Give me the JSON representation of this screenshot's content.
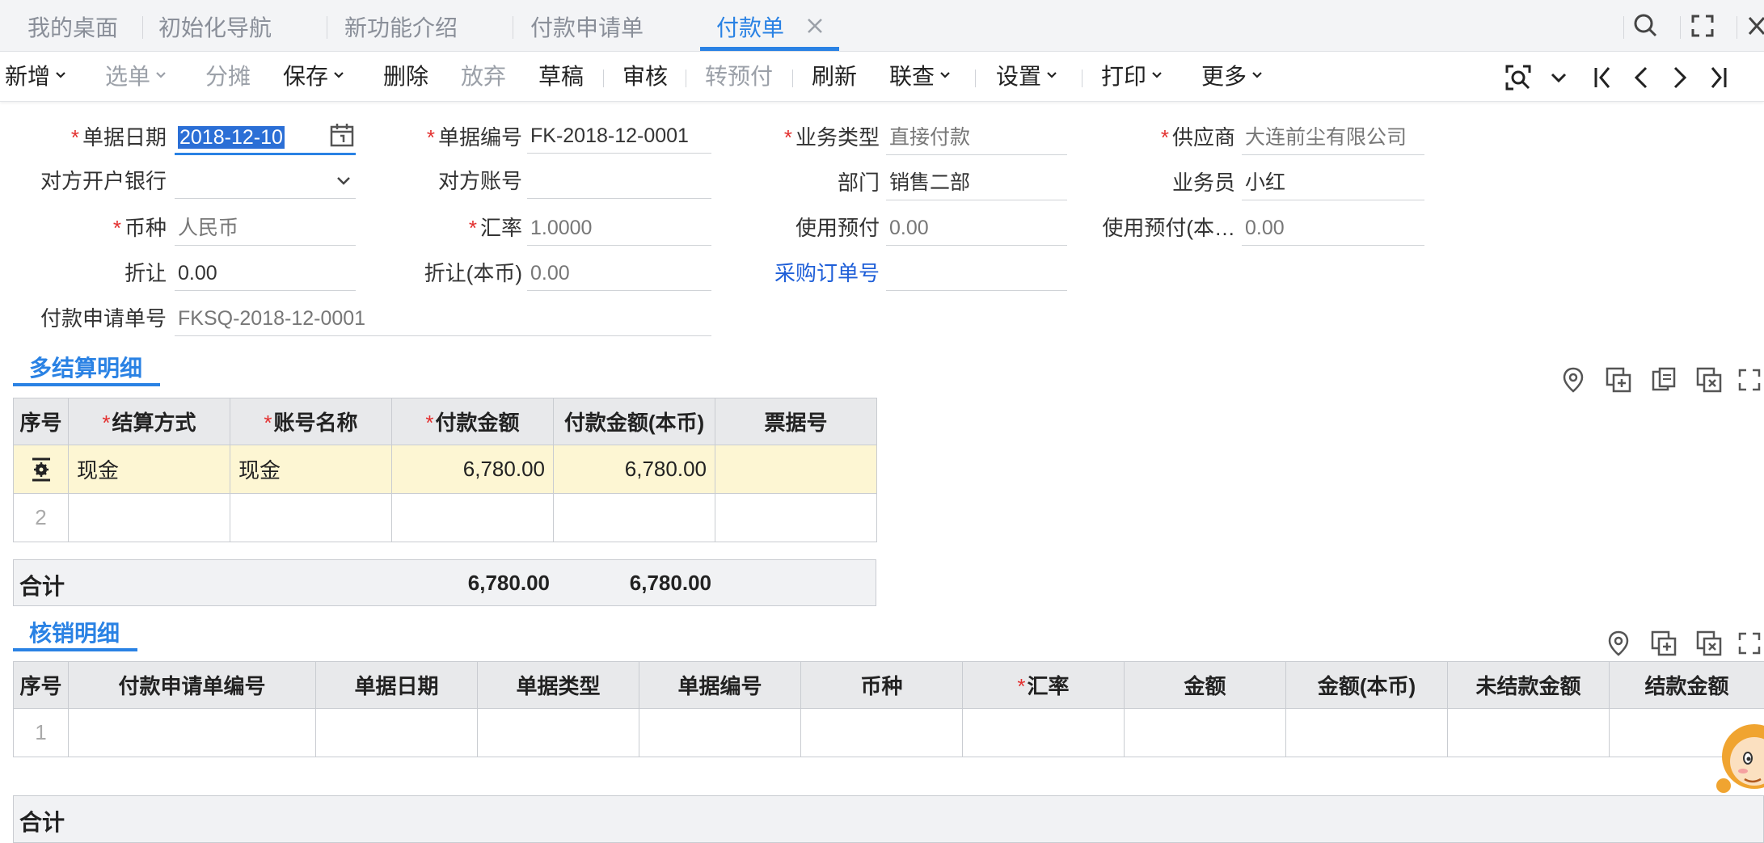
{
  "tabs": [
    "我的桌面",
    "初始化导航",
    "新功能介绍",
    "付款申请单",
    "付款单"
  ],
  "toolbar": {
    "add": "新增",
    "select": "选单",
    "split": "分摊",
    "save": "保存",
    "delete": "删除",
    "discard": "放弃",
    "draft": "草稿",
    "audit": "审核",
    "to_prepay": "转预付",
    "refresh": "刷新",
    "link_query": "联查",
    "settings": "设置",
    "print": "打印",
    "more": "更多"
  },
  "form": {
    "doc_date": {
      "label": "单据日期",
      "value": "2018-12-10"
    },
    "doc_no": {
      "label": "单据编号",
      "value": "FK-2018-12-0001"
    },
    "biz_type": {
      "label": "业务类型",
      "value": "直接付款"
    },
    "supplier": {
      "label": "供应商",
      "value": "大连前尘有限公司"
    },
    "bank": {
      "label": "对方开户银行",
      "value": ""
    },
    "account_no": {
      "label": "对方账号",
      "value": ""
    },
    "dept": {
      "label": "部门",
      "value": "销售二部"
    },
    "salesman": {
      "label": "业务员",
      "value": "小红"
    },
    "currency": {
      "label": "币种",
      "value": "人民币"
    },
    "rate": {
      "label": "汇率",
      "value": "1.0000"
    },
    "use_prepay": {
      "label": "使用预付",
      "value": "0.00"
    },
    "use_prepay_local": {
      "label": "使用预付(本…",
      "value": "0.00"
    },
    "discount": {
      "label": "折让",
      "value": "0.00"
    },
    "discount_local": {
      "label": "折让(本币)",
      "value": "0.00"
    },
    "po_no": {
      "label": "采购订单号",
      "value": ""
    },
    "req_no": {
      "label": "付款申请单号",
      "value": "FKSQ-2018-12-0001"
    }
  },
  "settlement": {
    "title": "多结算明细",
    "columns": [
      "序号",
      "结算方式",
      "账号名称",
      "付款金额",
      "付款金额(本币)",
      "票据号"
    ],
    "rows": [
      {
        "method": "现金",
        "account": "现金",
        "amount": "6,780.00",
        "amount_local": "6,780.00",
        "bill_no": ""
      },
      {
        "index": "2",
        "method": "",
        "account": "",
        "amount": "",
        "amount_local": "",
        "bill_no": ""
      }
    ],
    "total_label": "合计",
    "total_amount": "6,780.00",
    "total_amount_local": "6,780.00"
  },
  "writeoff": {
    "title": "核销明细",
    "columns": [
      "序号",
      "付款申请单编号",
      "单据日期",
      "单据类型",
      "单据编号",
      "币种",
      "汇率",
      "金额",
      "金额(本币)",
      "未结款金额",
      "结款金额"
    ],
    "rows": [
      {
        "index": "1"
      }
    ],
    "total_label": "合计"
  },
  "colors": {
    "accent": "#2a82e4",
    "required": "#e3302f",
    "row_highlight": "#fdf6d3",
    "link": "#1f5fd8"
  }
}
